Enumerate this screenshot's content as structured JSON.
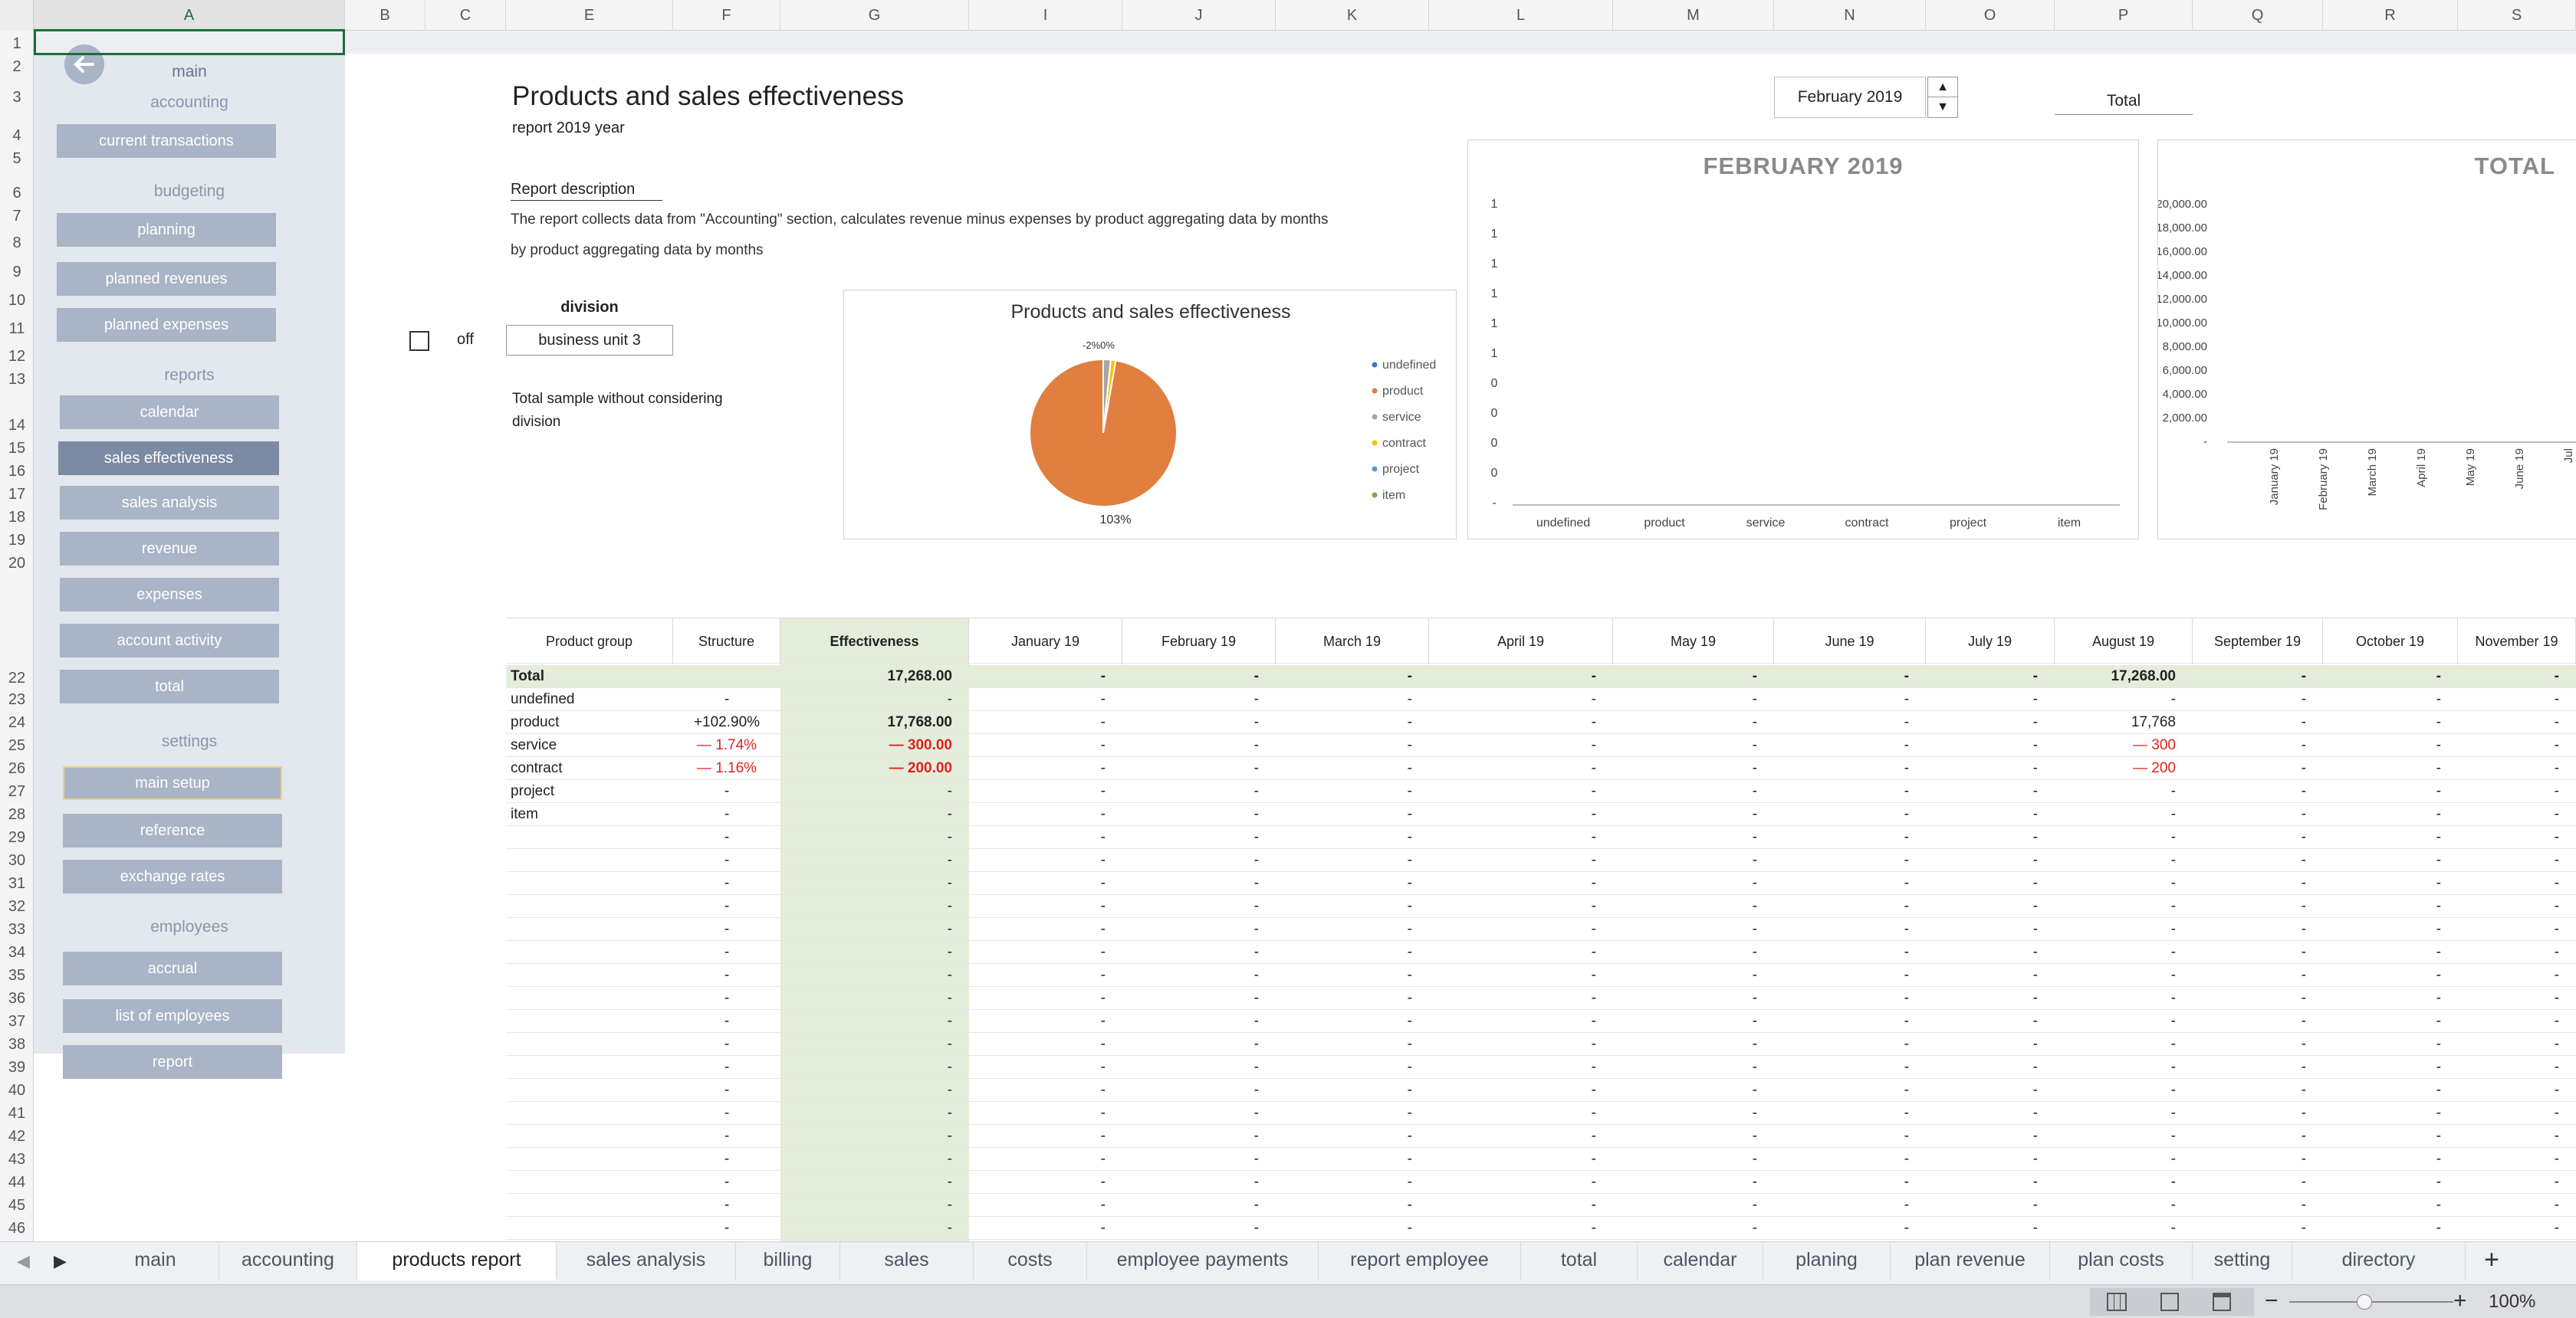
{
  "columns": [
    "A",
    "B",
    "C",
    "E",
    "F",
    "G",
    "I",
    "J",
    "K",
    "L",
    "M",
    "N",
    "O",
    "P",
    "Q",
    "R",
    "S"
  ],
  "rows": [
    "1",
    "2",
    "3",
    "4",
    "5",
    "6",
    "7",
    "8",
    "9",
    "10",
    "11",
    "12",
    "13",
    "14",
    "15",
    "16",
    "17",
    "18",
    "19",
    "20",
    "22",
    "23",
    "24",
    "25",
    "26",
    "27",
    "28",
    "29",
    "30",
    "31",
    "32",
    "33",
    "34",
    "35",
    "36",
    "37",
    "38",
    "39",
    "40",
    "41",
    "42",
    "43",
    "44",
    "45",
    "46"
  ],
  "sidebar": {
    "main": "main",
    "accounting": "accounting",
    "current_transactions": "current transactions",
    "budgeting": "budgeting",
    "planning": "planning",
    "planned_revenues": "planned revenues",
    "planned_expenses": "planned expenses",
    "reports": "reports",
    "calendar": "calendar",
    "sales_effectiveness": "sales effectiveness",
    "sales_analysis": "sales analysis",
    "revenue": "revenue",
    "expenses": "expenses",
    "account_activity": "account activity",
    "total": "total",
    "settings": "settings",
    "main_setup": "main setup",
    "reference": "reference",
    "exchange_rates": "exchange rates",
    "employees": "employees",
    "accrual": "accrual",
    "list_of_employees": "list of employees",
    "report": "report"
  },
  "header": {
    "title": "Products and sales effectiveness",
    "subtitle": "report 2019 year",
    "month": "February 2019",
    "total_label": "Total",
    "desc_title": "Report description",
    "desc_line1": "The report collects data from \"Accounting\" section, calculates revenue minus expenses by product aggregating data by months",
    "desc_line2": "by product aggregating data by months",
    "division_label": "division",
    "division_value": "business unit 3",
    "toggle_label": "off",
    "note": "Total sample without considering division"
  },
  "colors": {
    "accent": "#e07f3f",
    "sidebar_btn": "#a9b4c6",
    "active_btn": "#7c8ba4",
    "neg": "#dd2222",
    "eff_bg": "#e3edda"
  },
  "chart_data": [
    {
      "type": "pie",
      "title": "Products and sales effectiveness",
      "categories": [
        "undefined",
        "product",
        "service",
        "contract",
        "project",
        "item"
      ],
      "values": [
        0,
        102.9,
        -1.74,
        -1.16,
        0,
        0
      ],
      "colors": [
        "#4472c4",
        "#e07f3f",
        "#a5a5a5",
        "#ffc000",
        "#5b9bd5",
        "#70ad47"
      ],
      "top_label": "-2%0%",
      "bottom_label": "103%",
      "legend": "right"
    },
    {
      "type": "bar",
      "title": "FEBRUARY 2019",
      "categories": [
        "undefined",
        "product",
        "service",
        "contract",
        "project",
        "item"
      ],
      "values": [
        0,
        0,
        0,
        0,
        0,
        0
      ],
      "yticks": [
        "1",
        "1",
        "1",
        "1",
        "1",
        "1",
        "0",
        "0",
        "0",
        "0",
        "-"
      ]
    },
    {
      "type": "bar",
      "title": "TOTAL",
      "categories": [
        "January 19",
        "February 19",
        "March 19",
        "April 19",
        "May 19",
        "June 19",
        "Jul"
      ],
      "values": [
        0,
        0,
        0,
        0,
        0,
        0,
        0
      ],
      "yticks": [
        "20,000.00",
        "18,000.00",
        "16,000.00",
        "14,000.00",
        "12,000.00",
        "10,000.00",
        "8,000.00",
        "6,000.00",
        "4,000.00",
        "2,000.00",
        "-"
      ],
      "ylim": [
        0,
        20000
      ]
    }
  ],
  "table": {
    "headers": [
      "Product group",
      "Structure",
      "Effectiveness",
      "January 19",
      "February 19",
      "March 19",
      "April 19",
      "May 19",
      "June 19",
      "July 19",
      "August 19",
      "September 19",
      "October 19",
      "November 19"
    ],
    "rows": [
      {
        "name": "Total",
        "structure": "",
        "eff": "17,268.00",
        "aug": "17,268.00"
      },
      {
        "name": "undefined",
        "structure": "-",
        "eff": "-",
        "aug": "-"
      },
      {
        "name": "product",
        "structure": "+102.90%",
        "eff": "17,768.00",
        "aug": "17,768"
      },
      {
        "name": "service",
        "structure": "— 1.74%",
        "eff": "— 300.00",
        "aug": "— 300"
      },
      {
        "name": "contract",
        "structure": "— 1.16%",
        "eff": "— 200.00",
        "aug": "— 200"
      },
      {
        "name": "project",
        "structure": "-",
        "eff": "-",
        "aug": "-"
      },
      {
        "name": "item",
        "structure": "-",
        "eff": "-",
        "aug": "-"
      }
    ],
    "dash": "-"
  },
  "tabs": [
    "main",
    "accounting",
    "products report",
    "sales analysis",
    "billing",
    "sales",
    "costs",
    "employee payments",
    "report employee",
    "total",
    "calendar",
    "planing",
    "plan revenue",
    "plan costs",
    "setting",
    "directory"
  ],
  "add_tab": "+",
  "zoom": "100%"
}
